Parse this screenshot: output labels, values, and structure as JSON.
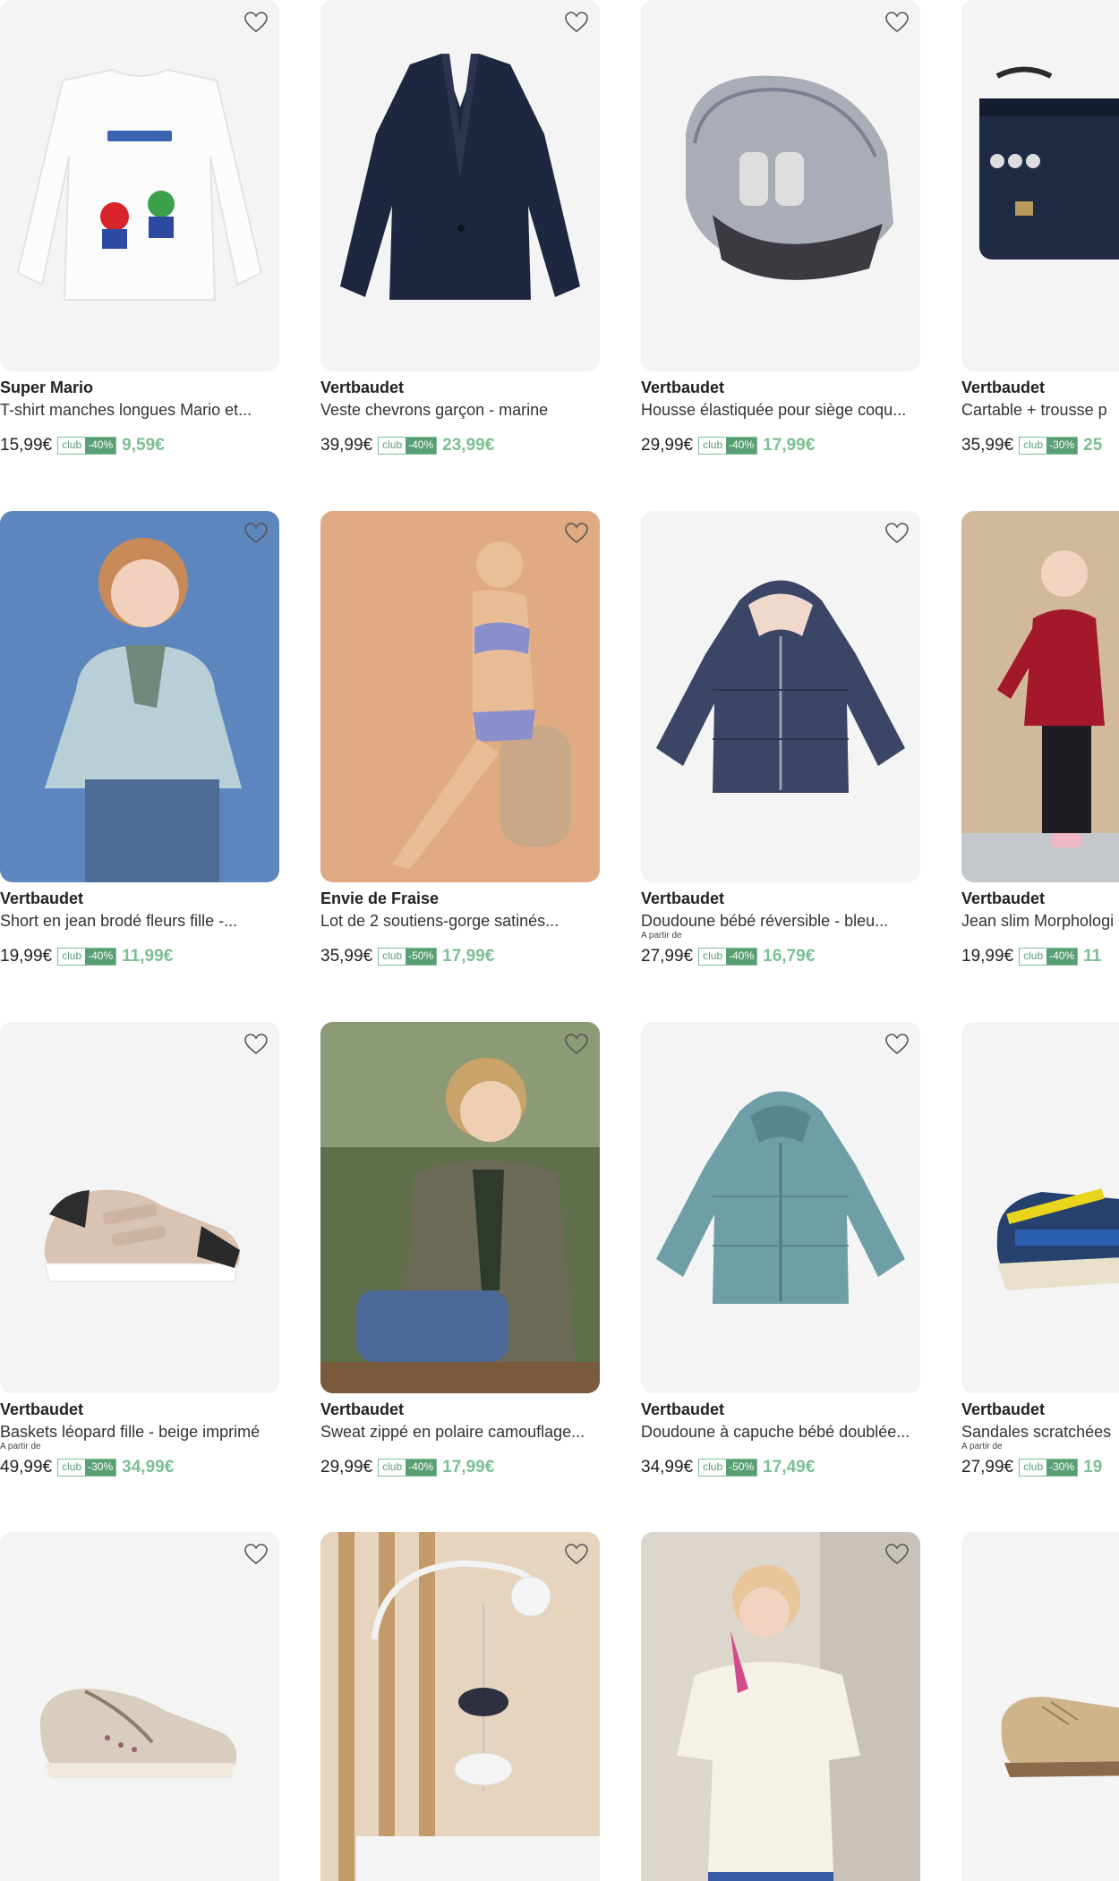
{
  "colors": {
    "accent_green": "#7bbf93",
    "club_green": "#5a9e74",
    "thumb_bg": "#f4f4f4"
  },
  "products": [
    {
      "brand": "Super Mario",
      "name": "T-shirt manches longues Mario et...",
      "from": "",
      "old_price": "15,99€",
      "club": "club",
      "discount": "-40%",
      "price": "9,59€",
      "image": "white-longsleeve-tshirt-mario",
      "icon": "heart-icon"
    },
    {
      "brand": "Vertbaudet",
      "name": "Veste chevrons garçon - marine",
      "from": "",
      "old_price": "39,99€",
      "club": "club",
      "discount": "-40%",
      "price": "23,99€",
      "image": "navy-blazer",
      "icon": "heart-icon"
    },
    {
      "brand": "Vertbaudet",
      "name": "Housse élastiquée pour siège coqu...",
      "from": "",
      "old_price": "29,99€",
      "club": "club",
      "discount": "-40%",
      "price": "17,99€",
      "image": "car-seat-cover",
      "icon": "heart-icon"
    },
    {
      "brand": "Vertbaudet",
      "name": "Cartable + trousse p",
      "from": "",
      "old_price": "35,99€",
      "club": "club",
      "discount": "-30%",
      "price": "25",
      "image": "school-bag",
      "icon": "heart-icon"
    },
    {
      "brand": "Vertbaudet",
      "name": "Short en jean brodé fleurs fille -...",
      "from": "",
      "old_price": "19,99€",
      "club": "club",
      "discount": "-40%",
      "price": "11,99€",
      "image": "girl-in-sweater-photo",
      "icon": "heart-icon"
    },
    {
      "brand": "Envie de Fraise",
      "name": "Lot de 2 soutiens-gorge satinés...",
      "from": "",
      "old_price": "35,99€",
      "club": "club",
      "discount": "-50%",
      "price": "17,99€",
      "image": "lingerie-photo",
      "icon": "heart-icon"
    },
    {
      "brand": "Vertbaudet",
      "name": "Doudoune bébé réversible - bleu...",
      "from": "A partir de",
      "old_price": "27,99€",
      "club": "club",
      "discount": "-40%",
      "price": "16,79€",
      "image": "navy-puffer-jacket",
      "icon": "heart-icon"
    },
    {
      "brand": "Vertbaudet",
      "name": "Jean slim Morphologi",
      "from": "",
      "old_price": "19,99€",
      "club": "club",
      "discount": "-40%",
      "price": "11",
      "image": "girl-red-cardigan-photo",
      "icon": "heart-icon"
    },
    {
      "brand": "Vertbaudet",
      "name": "Baskets léopard fille - beige imprimé",
      "from": "A partir de",
      "old_price": "49,99€",
      "club": "club",
      "discount": "-30%",
      "price": "34,99€",
      "image": "leopard-sneaker",
      "icon": "heart-icon"
    },
    {
      "brand": "Vertbaudet",
      "name": "Sweat zippé en polaire camouflage...",
      "from": "",
      "old_price": "29,99€",
      "club": "club",
      "discount": "-40%",
      "price": "17,99€",
      "image": "boy-camo-fleece-photo",
      "icon": "heart-icon"
    },
    {
      "brand": "Vertbaudet",
      "name": "Doudoune à capuche bébé doublée...",
      "from": "",
      "old_price": "34,99€",
      "club": "club",
      "discount": "-50%",
      "price": "17,49€",
      "image": "teal-puffer-jacket",
      "icon": "heart-icon"
    },
    {
      "brand": "Vertbaudet",
      "name": "Sandales scratchées",
      "from": "A partir de",
      "old_price": "27,99€",
      "club": "club",
      "discount": "-30%",
      "price": "19",
      "image": "blue-sandal",
      "icon": "heart-icon"
    },
    {
      "brand": "",
      "name": "",
      "from": "",
      "old_price": "",
      "club": "",
      "discount": "",
      "price": "",
      "image": "beige-shoe",
      "icon": "heart-icon"
    },
    {
      "brand": "",
      "name": "",
      "from": "",
      "old_price": "",
      "club": "",
      "discount": "",
      "price": "",
      "image": "baby-mobile-photo",
      "icon": "heart-icon"
    },
    {
      "brand": "",
      "name": "",
      "from": "",
      "old_price": "",
      "club": "",
      "discount": "",
      "price": "",
      "image": "woman-white-blouse-photo",
      "icon": "heart-icon"
    },
    {
      "brand": "",
      "name": "",
      "from": "",
      "old_price": "",
      "club": "",
      "discount": "",
      "price": "",
      "image": "gold-derby-shoe",
      "icon": "heart-icon"
    }
  ]
}
